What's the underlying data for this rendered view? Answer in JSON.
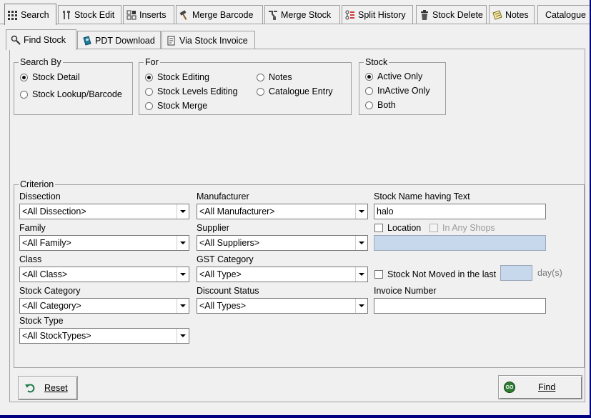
{
  "tabs": [
    {
      "label": "Search",
      "icon": "grid-icon",
      "active": true
    },
    {
      "label": "Stock Edit",
      "icon": "tools-icon"
    },
    {
      "label": "Inserts",
      "icon": "inserts-icon"
    },
    {
      "label": "Merge Barcode",
      "icon": "hammer-icon"
    },
    {
      "label": "Merge Stock",
      "icon": "merge-icon"
    },
    {
      "label": "Split History",
      "icon": "split-icon"
    },
    {
      "label": "Stock Delete",
      "icon": "trash-icon"
    },
    {
      "label": "Notes",
      "icon": "notes-icon"
    },
    {
      "label": "Catalogue",
      "icon": ""
    }
  ],
  "subtabs": [
    {
      "label": "Find Stock",
      "icon": "search-icon",
      "active": true
    },
    {
      "label": "PDT Download",
      "icon": "pdt-icon"
    },
    {
      "label": "Via Stock Invoice",
      "icon": "invoice-icon"
    }
  ],
  "search_by": {
    "title": "Search By",
    "options": [
      {
        "label": "Stock Detail",
        "selected": true
      },
      {
        "label": "Stock Lookup/Barcode",
        "selected": false
      }
    ]
  },
  "for": {
    "title": "For",
    "options": [
      {
        "label": "Stock Editing",
        "selected": true
      },
      {
        "label": "Stock Levels Editing",
        "selected": false
      },
      {
        "label": "Stock Merge",
        "selected": false
      },
      {
        "label": "Notes",
        "selected": false
      },
      {
        "label": "Catalogue Entry",
        "selected": false
      }
    ]
  },
  "stock": {
    "title": "Stock",
    "options": [
      {
        "label": "Active Only",
        "selected": true
      },
      {
        "label": "InActive Only",
        "selected": false
      },
      {
        "label": "Both",
        "selected": false
      }
    ]
  },
  "criterion": {
    "title": "Criterion",
    "dissection": {
      "label": "Dissection",
      "value": "<All Dissection>"
    },
    "family": {
      "label": "Family",
      "value": "<All Family>"
    },
    "class": {
      "label": "Class",
      "value": "<All Class>"
    },
    "stock_category": {
      "label": "Stock Category",
      "value": "<All Category>"
    },
    "stock_type": {
      "label": "Stock Type",
      "value": "<All StockTypes>"
    },
    "manufacturer": {
      "label": "Manufacturer",
      "value": "<All Manufacturer>"
    },
    "supplier": {
      "label": "Supplier",
      "value": "<All Suppliers>"
    },
    "gst_category": {
      "label": "GST Category",
      "value": "<All Type>"
    },
    "discount_status": {
      "label": "Discount Status",
      "value": "<All Types>"
    },
    "stock_name": {
      "label": "Stock Name having Text",
      "value": "halo"
    },
    "location": {
      "label": "Location",
      "checked": false
    },
    "in_any_shops": {
      "label": "In Any Shops",
      "checked": false,
      "disabled": true
    },
    "location_value": "",
    "not_moved": {
      "label": "Stock Not Moved in the last",
      "checked": false,
      "value": "",
      "suffix": "day(s)"
    },
    "invoice_number": {
      "label": "Invoice Number",
      "value": ""
    }
  },
  "buttons": {
    "reset": "Reset",
    "find": "Find",
    "find_badge": "GO"
  },
  "colors": {
    "window_bg": "#f0f0f0",
    "frame_border": "#000080",
    "disabled_field": "#c8d8ec",
    "go_badge": "#2e7d32"
  }
}
